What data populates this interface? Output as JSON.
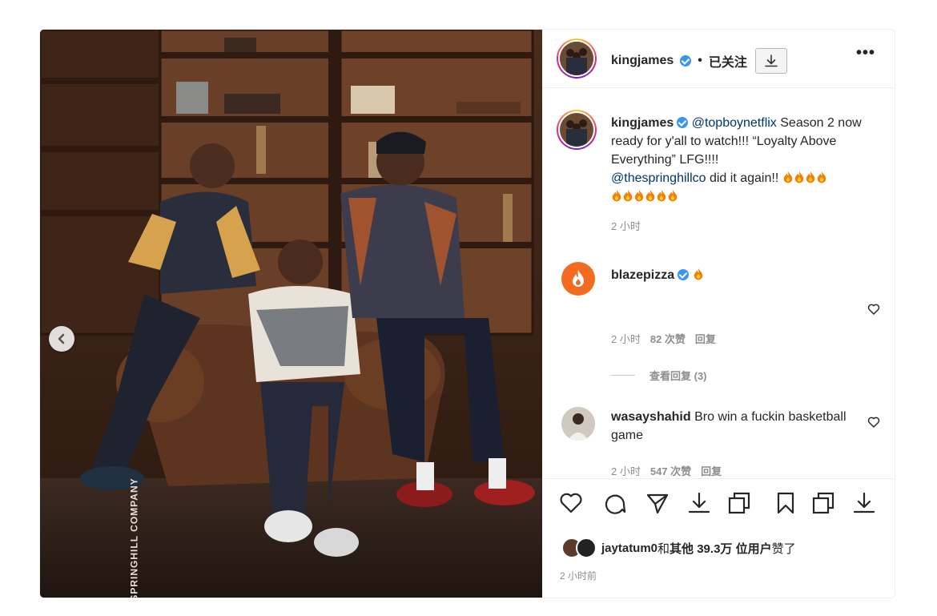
{
  "photo": {
    "watermark": "SPRINGHILL COMPANY",
    "prev_icon": "chevron-left-icon"
  },
  "header": {
    "username": "kingjames",
    "separator": "•",
    "follow_status": "已关注",
    "download_icon": "download-icon",
    "more_icon": "more-horizontal-icon",
    "more_label": "•••"
  },
  "caption": {
    "username": "kingjames",
    "mention1": "@topboynetflix",
    "text1": " Season 2 now ready for y'all to watch!!! “Loyalty Above Everything” LFG!!!!",
    "mention2": "@thespringhillco",
    "text2": " did it again!! ",
    "fire_count_1": 4,
    "fire_count_2": 6,
    "time": "2 小时"
  },
  "comments": [
    {
      "username": "blazepizza",
      "verified": true,
      "text": "",
      "fire_count": 1,
      "time": "2 小时",
      "likes": "82 次赞",
      "reply": "回复",
      "view_replies": "查看回复 (3)"
    },
    {
      "username": "wasayshahid",
      "verified": false,
      "text": "Bro win a fuckin basketball game",
      "time": "2 小时",
      "likes": "547 次赞",
      "reply": "回复"
    }
  ],
  "actions": [
    "heart-icon",
    "comment-icon",
    "share-icon",
    "download-icon",
    "copy-icon",
    "bookmark-icon",
    "copy-icon",
    "download-icon"
  ],
  "likes": {
    "user": "jaytatum0",
    "and": " 和 ",
    "others": "其他 39.3万 位用户",
    "suffix": " 赞了"
  },
  "post_time": "2 小时前",
  "colors": {
    "link": "#00376b",
    "verified": "#3897f0",
    "meta": "#8e8e8e",
    "fire": "#f77f00"
  }
}
